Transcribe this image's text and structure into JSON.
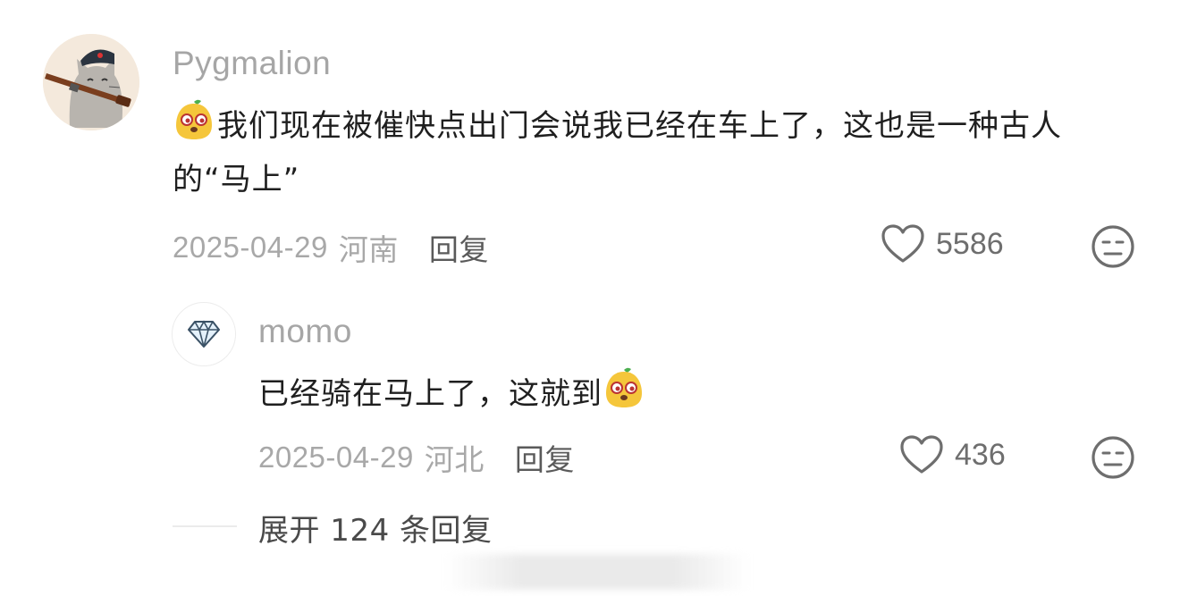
{
  "comments": [
    {
      "username": "Pygmalion",
      "avatar_icon": "cat-with-rifle-avatar",
      "emoji": "yellow-face-emoji",
      "text": "我们现在被催快点出门会说我已经在车上了，这也是一种古人的“马上”",
      "date": "2025-04-29",
      "location": "河南",
      "reply_label": "回复",
      "likes": "5586"
    },
    {
      "username": "momo",
      "avatar_icon": "diamond-avatar",
      "emoji": "yellow-face-emoji",
      "text": "已经骑在马上了，这就到",
      "date": "2025-04-29",
      "location": "河北",
      "reply_label": "回复",
      "likes": "436"
    }
  ],
  "expand_label": "展开 124 条回复",
  "colors": {
    "secondary_text": "#a6a6a6",
    "primary_text": "#1f1f1f",
    "emoji_yellow": "#f5c63b"
  }
}
